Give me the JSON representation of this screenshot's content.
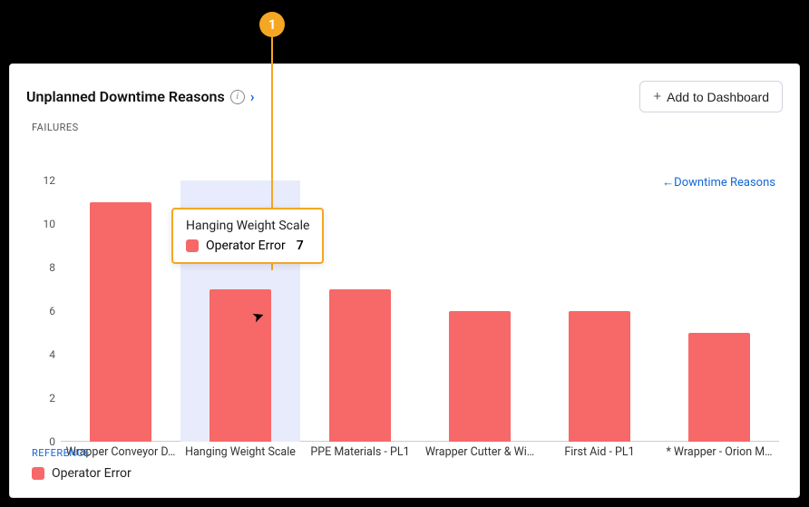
{
  "header": {
    "title": "Unplanned Downtime Reasons",
    "add_button": "Add to Dashboard"
  },
  "link": {
    "back_label": "Downtime Reasons"
  },
  "reference_header": "REFERENCE",
  "legend": {
    "series_name": "Operator Error"
  },
  "tooltip": {
    "category": "Hanging Weight Scale",
    "series": "Operator Error",
    "value": "7"
  },
  "annotation": {
    "number": "1"
  },
  "chart_data": {
    "type": "bar",
    "title": "Unplanned Downtime Reasons",
    "ylabel": "FAILURES",
    "xlabel": "",
    "ylim": [
      0,
      12
    ],
    "yticks": [
      0,
      2,
      4,
      6,
      8,
      10,
      12
    ],
    "categories": [
      "Wrapper Conveyor D…",
      "Hanging Weight Scale",
      "PPE Materials - PL1",
      "Wrapper Cutter & Wi…",
      "First Aid - PL1",
      "* Wrapper - Orion M…"
    ],
    "series": [
      {
        "name": "Operator Error",
        "values": [
          11,
          7,
          7,
          6,
          6,
          5
        ],
        "color": "#f76868"
      }
    ],
    "highlight_index": 1
  }
}
